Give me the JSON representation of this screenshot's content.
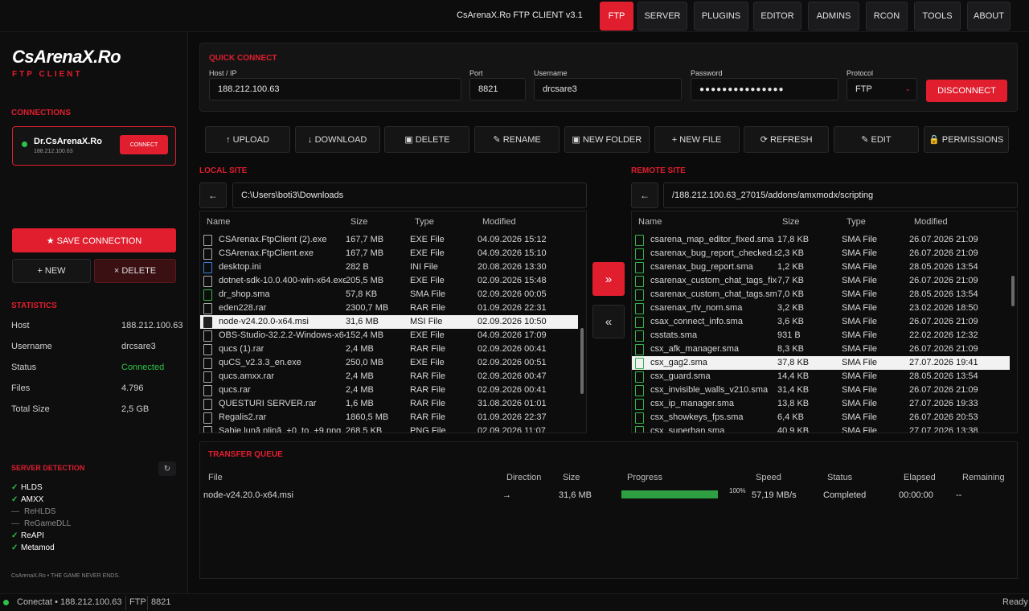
{
  "app": {
    "title": "CsArenaX.Ro FTP CLIENT v3.1"
  },
  "nav": {
    "tabs": [
      "FTP",
      "SERVER",
      "PLUGINS",
      "EDITOR",
      "ADMINS",
      "RCON",
      "TOOLS",
      "ABOUT"
    ],
    "active": "FTP"
  },
  "sidebar": {
    "logo": "CsArenaX.Ro",
    "logo_sub": "FTP CLIENT",
    "connections_title": "CONNECTIONS",
    "connection": {
      "name": "Dr.CsArenaX.Ro",
      "ip": "188.212.100.63",
      "button": "CONNECT"
    },
    "save_button": "★  SAVE CONNECTION",
    "new_button": "+ NEW",
    "delete_button": "× DELETE",
    "statistics_title": "STATISTICS",
    "stats": [
      {
        "k": "Host",
        "v": "188.212.100.63"
      },
      {
        "k": "Username",
        "v": "drcsare3"
      },
      {
        "k": "Status",
        "v": "Connected"
      },
      {
        "k": "Files",
        "v": "4.796"
      },
      {
        "k": "Total Size",
        "v": "2,5 GB"
      }
    ],
    "detection_title": "SERVER DETECTION",
    "refresh_glyph": "↻",
    "detection": [
      {
        "name": "HLDS",
        "on": true
      },
      {
        "name": "AMXX",
        "on": true
      },
      {
        "name": "ReHLDS",
        "on": false
      },
      {
        "name": "ReGameDLL",
        "on": false
      },
      {
        "name": "ReAPI",
        "on": true
      },
      {
        "name": "Metamod",
        "on": true
      }
    ],
    "footer": "CsArenaX.Ro • THE GAME NEVER ENDS."
  },
  "quick_connect": {
    "title": "QUICK CONNECT",
    "host_label": "Host / IP",
    "host": "188.212.100.63",
    "port_label": "Port",
    "port": "8821",
    "user_label": "Username",
    "user": "drcsare3",
    "pass_label": "Password",
    "pass": "●●●●●●●●●●●●●●●",
    "proto_label": "Protocol",
    "proto": "FTP",
    "proto_arrow": "⌄",
    "disconnect": "DISCONNECT"
  },
  "toolbar": [
    "↑ UPLOAD",
    "↓ DOWNLOAD",
    "▣ DELETE",
    "✎ RENAME",
    "▣ NEW FOLDER",
    "+ NEW FILE",
    "⟳ REFRESH",
    "✎ EDIT",
    "🔒 PERMISSIONS"
  ],
  "local": {
    "title": "LOCAL SITE",
    "path": "C:\\Users\\boti3\\Downloads",
    "back": "←",
    "columns": [
      "Name",
      "Size",
      "Type",
      "Modified"
    ],
    "files": [
      {
        "n": "CSArenax.FtpClient (2).exe",
        "s": "167,7 MB",
        "t": "EXE File",
        "m": "04.09.2026 15:12",
        "i": "grey"
      },
      {
        "n": "CSArenax.FtpClient.exe",
        "s": "167,7 MB",
        "t": "EXE File",
        "m": "04.09.2026 15:10",
        "i": "grey"
      },
      {
        "n": "desktop.ini",
        "s": "282 B",
        "t": "INI File",
        "m": "20.08.2026 13:30",
        "i": "blue"
      },
      {
        "n": "dotnet-sdk-10.0.400-win-x64.exe",
        "s": "205,5 MB",
        "t": "EXE File",
        "m": "02.09.2026 15:48",
        "i": "grey"
      },
      {
        "n": "dr_shop.sma",
        "s": "57,8 KB",
        "t": "SMA File",
        "m": "02.09.2026 00:05",
        "i": "green"
      },
      {
        "n": "eden228.rar",
        "s": "2300,7 MB",
        "t": "RAR File",
        "m": "01.09.2026 22:31",
        "i": "grey"
      },
      {
        "n": "node-v24.20.0-x64.msi",
        "s": "31,6 MB",
        "t": "MSI File",
        "m": "02.09.2026 10:50",
        "i": "dark",
        "sel": true
      },
      {
        "n": "OBS-Studio-32.2.2-Windows-x64",
        "s": "152,4 MB",
        "t": "EXE File",
        "m": "04.09.2026 17:09",
        "i": "grey"
      },
      {
        "n": "qucs (1).rar",
        "s": "2,4 MB",
        "t": "RAR File",
        "m": "02.09.2026 00:41",
        "i": "grey"
      },
      {
        "n": "quCS_v2.3.3_en.exe",
        "s": "250,0 MB",
        "t": "EXE File",
        "m": "02.09.2026 00:51",
        "i": "grey"
      },
      {
        "n": "qucs.amxx.rar",
        "s": "2,4 MB",
        "t": "RAR File",
        "m": "02.09.2026 00:47",
        "i": "grey"
      },
      {
        "n": "qucs.rar",
        "s": "2,4 MB",
        "t": "RAR File",
        "m": "02.09.2026 00:41",
        "i": "grey"
      },
      {
        "n": "QUESTURI SERVER.rar",
        "s": "1,6 MB",
        "t": "RAR File",
        "m": "31.08.2026 01:01",
        "i": "grey"
      },
      {
        "n": "Regalis2.rar",
        "s": "1860,5 MB",
        "t": "RAR File",
        "m": "01.09.2026 22:37",
        "i": "grey"
      },
      {
        "n": "Sabie lună plină_+0_to_+9.png",
        "s": "268,5 KB",
        "t": "PNG File",
        "m": "02.09.2026 11:07",
        "i": "grey"
      }
    ]
  },
  "remote": {
    "title": "REMOTE SITE",
    "path": "/188.212.100.63_27015/addons/amxmodx/scripting",
    "back": "←",
    "columns": [
      "Name",
      "Size",
      "Type",
      "Modified"
    ],
    "files": [
      {
        "n": "csarena_map_editor_fixed.sma",
        "s": "17,8 KB",
        "t": "SMA File",
        "m": "26.07.2026 21:09"
      },
      {
        "n": "csarenax_bug_report_checked.sma",
        "s": "2,3 KB",
        "t": "SMA File",
        "m": "26.07.2026 21:09"
      },
      {
        "n": "csarenax_bug_report.sma",
        "s": "1,2 KB",
        "t": "SMA File",
        "m": "28.05.2026 13:54"
      },
      {
        "n": "csarenax_custom_chat_tags_fixed.sma",
        "s": "7,7 KB",
        "t": "SMA File",
        "m": "26.07.2026 21:09"
      },
      {
        "n": "csarenax_custom_chat_tags.sma",
        "s": "7,0 KB",
        "t": "SMA File",
        "m": "28.05.2026 13:54"
      },
      {
        "n": "csarenax_rtv_nom.sma",
        "s": "3,2 KB",
        "t": "SMA File",
        "m": "23.02.2026 18:50"
      },
      {
        "n": "csax_connect_info.sma",
        "s": "3,6 KB",
        "t": "SMA File",
        "m": "26.07.2026 21:09"
      },
      {
        "n": "csstats.sma",
        "s": "931 B",
        "t": "SMA File",
        "m": "22.02.2026 12:32"
      },
      {
        "n": "csx_afk_manager.sma",
        "s": "8,3 KB",
        "t": "SMA File",
        "m": "26.07.2026 21:09"
      },
      {
        "n": "csx_gag2.sma",
        "s": "37,8 KB",
        "t": "SMA File",
        "m": "27.07.2026 19:41",
        "sel": true
      },
      {
        "n": "csx_guard.sma",
        "s": "14,4 KB",
        "t": "SMA File",
        "m": "28.05.2026 13:54"
      },
      {
        "n": "csx_invisible_walls_v210.sma",
        "s": "31,4 KB",
        "t": "SMA File",
        "m": "26.07.2026 21:09"
      },
      {
        "n": "csx_ip_manager.sma",
        "s": "13,8 KB",
        "t": "SMA File",
        "m": "27.07.2026 19:33"
      },
      {
        "n": "csx_showkeys_fps.sma",
        "s": "6,4 KB",
        "t": "SMA File",
        "m": "26.07.2026 20:53"
      },
      {
        "n": "csx_superban.sma",
        "s": "40,9 KB",
        "t": "SMA File",
        "m": "27.07.2026 13:38"
      }
    ]
  },
  "transfer": {
    "upload": "»",
    "download": "«"
  },
  "queue": {
    "title": "TRANSFER QUEUE",
    "columns": [
      "File",
      "Direction",
      "Size",
      "Progress",
      "Speed",
      "Status",
      "Elapsed",
      "Remaining"
    ],
    "row": {
      "file": "node-v24.20.0-x64.msi",
      "direction": "→",
      "size": "31,6 MB",
      "progress": 1.0,
      "progress_label": "100%",
      "speed": "57,19 MB/s",
      "status": "Completed",
      "elapsed": "00:00:00",
      "remaining": "--"
    }
  },
  "statusbar": {
    "text": "Conectat • 188.212.100.63",
    "proto": "FTP",
    "port": "8821",
    "ready": "Ready"
  },
  "colors": {
    "accent": "#e01e2e",
    "ok": "#2ec24a",
    "sma": "#35b34a",
    "ini": "#3b7ddd"
  }
}
